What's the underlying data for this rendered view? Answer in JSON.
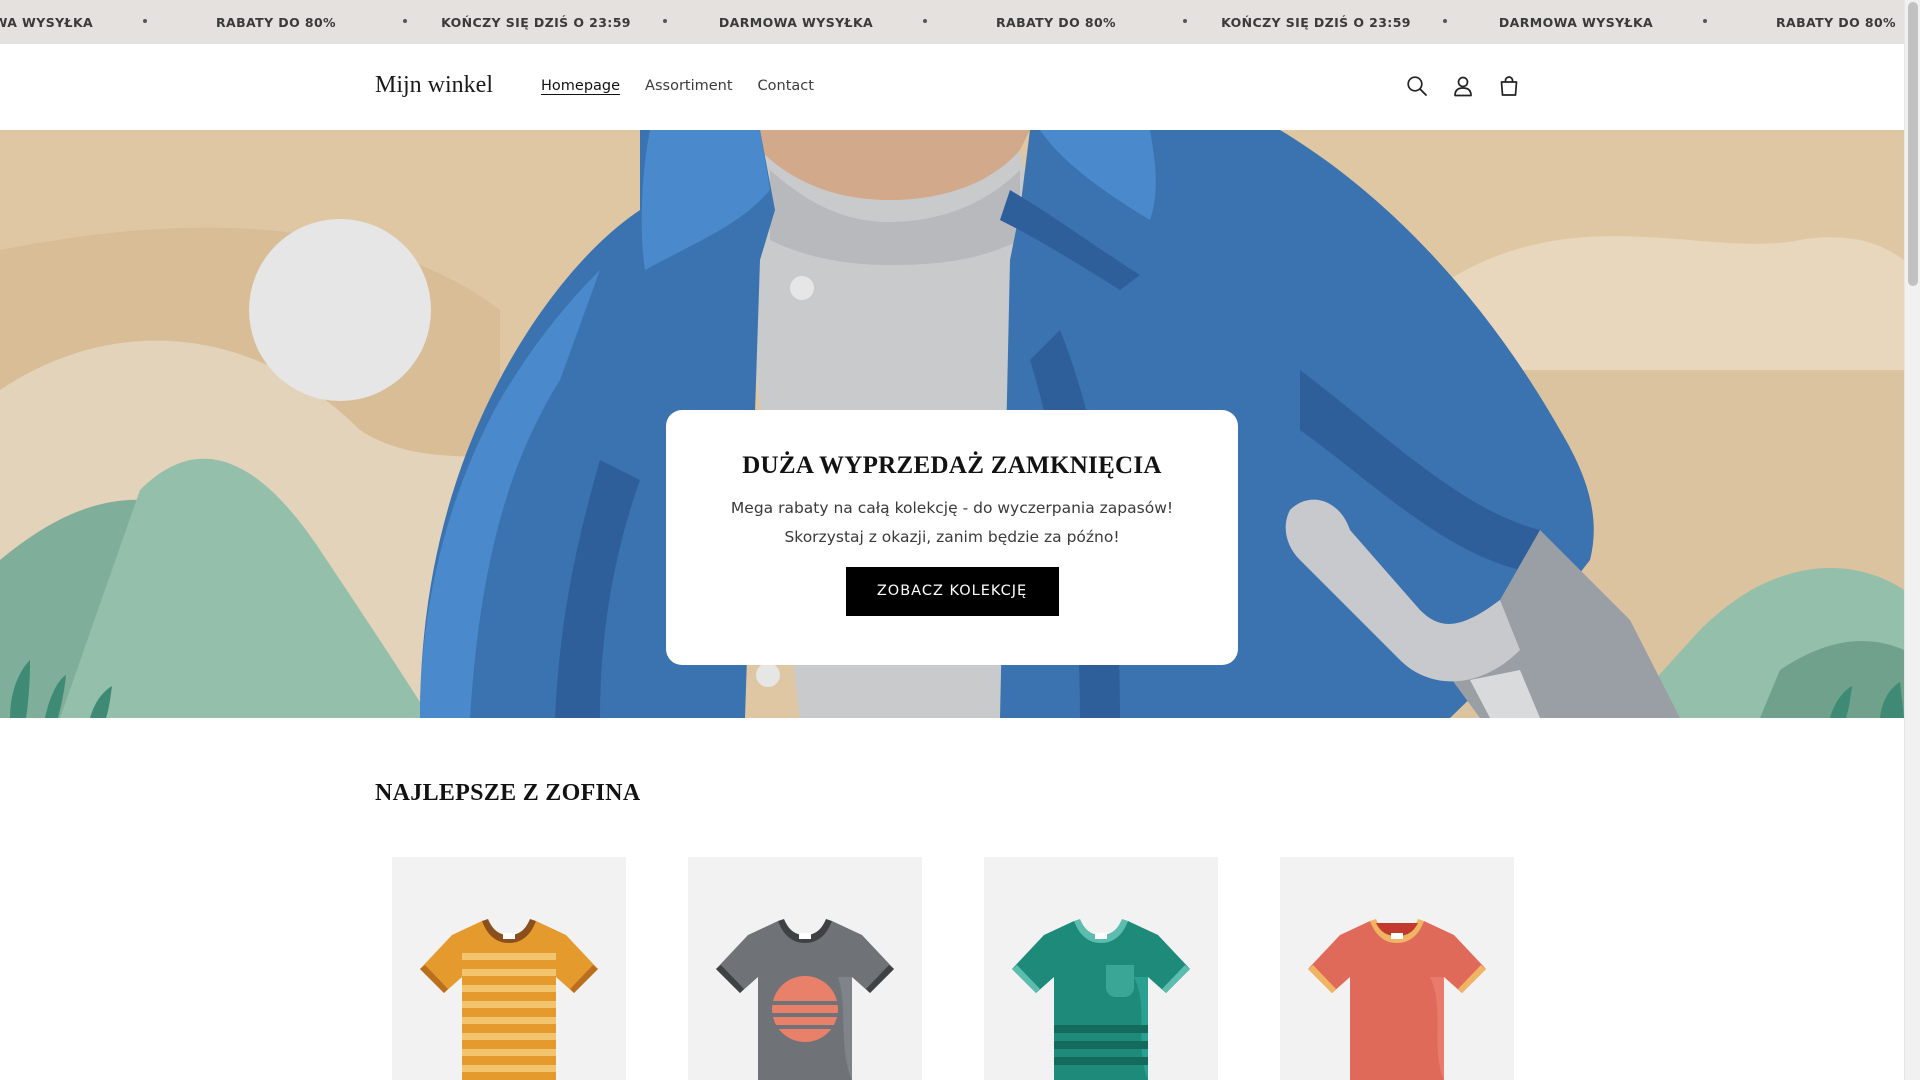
{
  "announcement": {
    "items": [
      "DARMOWA WYSYŁKA",
      "RABATY DO 80%",
      "KOŃCZY SIĘ DZIŚ O 23:59",
      "DARMOWA WYSYŁKA",
      "RABATY DO 80%",
      "KOŃCZY SIĘ DZIŚ O 23:59",
      "DARMOWA WYSYŁKA",
      "RABATY DO 80%"
    ]
  },
  "header": {
    "logo": "Mijn winkel",
    "nav": [
      {
        "label": "Homepage",
        "active": true
      },
      {
        "label": "Assortiment",
        "active": false
      },
      {
        "label": "Contact",
        "active": false
      }
    ],
    "icons": [
      "search-icon",
      "account-icon",
      "cart-icon"
    ]
  },
  "hero": {
    "title": "DUŻA WYPRZEDAŻ ZAMKNIĘCIA",
    "text_line1": "Mega rabaty na całą kolekcję - do wyczerpania zapasów!",
    "text_line2": "Skorzystaj z okazji, zanim będzie za późno!",
    "button_label": "ZOBACZ KOLEKCJĘ"
  },
  "collection": {
    "title": "NAJLEPSZE Z ZOFINA",
    "products": [
      {
        "image": "striped-orange-tshirt",
        "color": "#e49a2c"
      },
      {
        "image": "gray-sunset-tshirt",
        "color": "#6f7378"
      },
      {
        "image": "teal-pocket-tshirt",
        "color": "#1d8a7a"
      },
      {
        "image": "coral-tshirt",
        "color": "#e06a5a"
      }
    ]
  },
  "colors": {
    "accent": "#000000",
    "announcement_bg": "#e4e1de",
    "hero_sand": "#e0c7a3",
    "hero_jacket": "#3a73b0"
  }
}
